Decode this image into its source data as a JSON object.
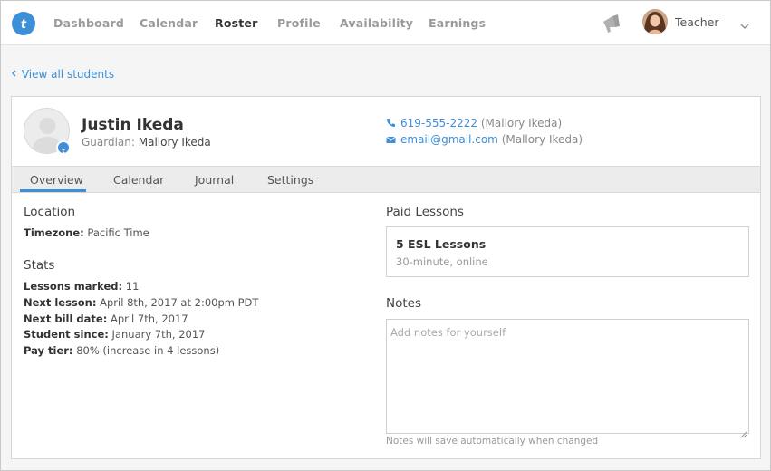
{
  "nav": {
    "items": [
      {
        "label": "Dashboard",
        "active": false
      },
      {
        "label": "Calendar",
        "active": false
      },
      {
        "label": "Roster",
        "active": true
      },
      {
        "label": "Profile",
        "active": false
      },
      {
        "label": "Availability",
        "active": false
      },
      {
        "label": "Earnings",
        "active": false
      }
    ],
    "user_name": "Teacher",
    "accent_color": "#3d8fd8"
  },
  "back_link": "View all students",
  "student": {
    "name": "Justin Ikeda",
    "guardian_label": "Guardian:",
    "guardian_name": "Mallory Ikeda",
    "phone": "619-555-2222",
    "phone_owner": "(Mallory Ikeda)",
    "email": "email@gmail.com",
    "email_owner": "(Mallory Ikeda)"
  },
  "tabs": [
    {
      "label": "Overview",
      "active": true
    },
    {
      "label": "Calendar",
      "active": false
    },
    {
      "label": "Journal",
      "active": false
    },
    {
      "label": "Settings",
      "active": false
    }
  ],
  "location": {
    "title": "Location",
    "timezone_label": "Timezone:",
    "timezone_value": "Pacific Time"
  },
  "stats": {
    "title": "Stats",
    "rows": [
      {
        "label": "Lessons marked:",
        "value": "11"
      },
      {
        "label": "Next lesson:",
        "value": "April 8th, 2017 at 2:00pm PDT"
      },
      {
        "label": "Next bill date:",
        "value": "April 7th, 2017"
      },
      {
        "label": "Student since:",
        "value": "January 7th, 2017"
      },
      {
        "label": "Pay tier:",
        "value": "80% (increase in 4 lessons)"
      }
    ]
  },
  "paid_lessons": {
    "title": "Paid Lessons",
    "lesson_title": "5 ESL Lessons",
    "lesson_detail": "30-minute, online"
  },
  "notes": {
    "title": "Notes",
    "placeholder": "Add notes for yourself",
    "value": "",
    "hint": "Notes will save automatically when changed"
  }
}
